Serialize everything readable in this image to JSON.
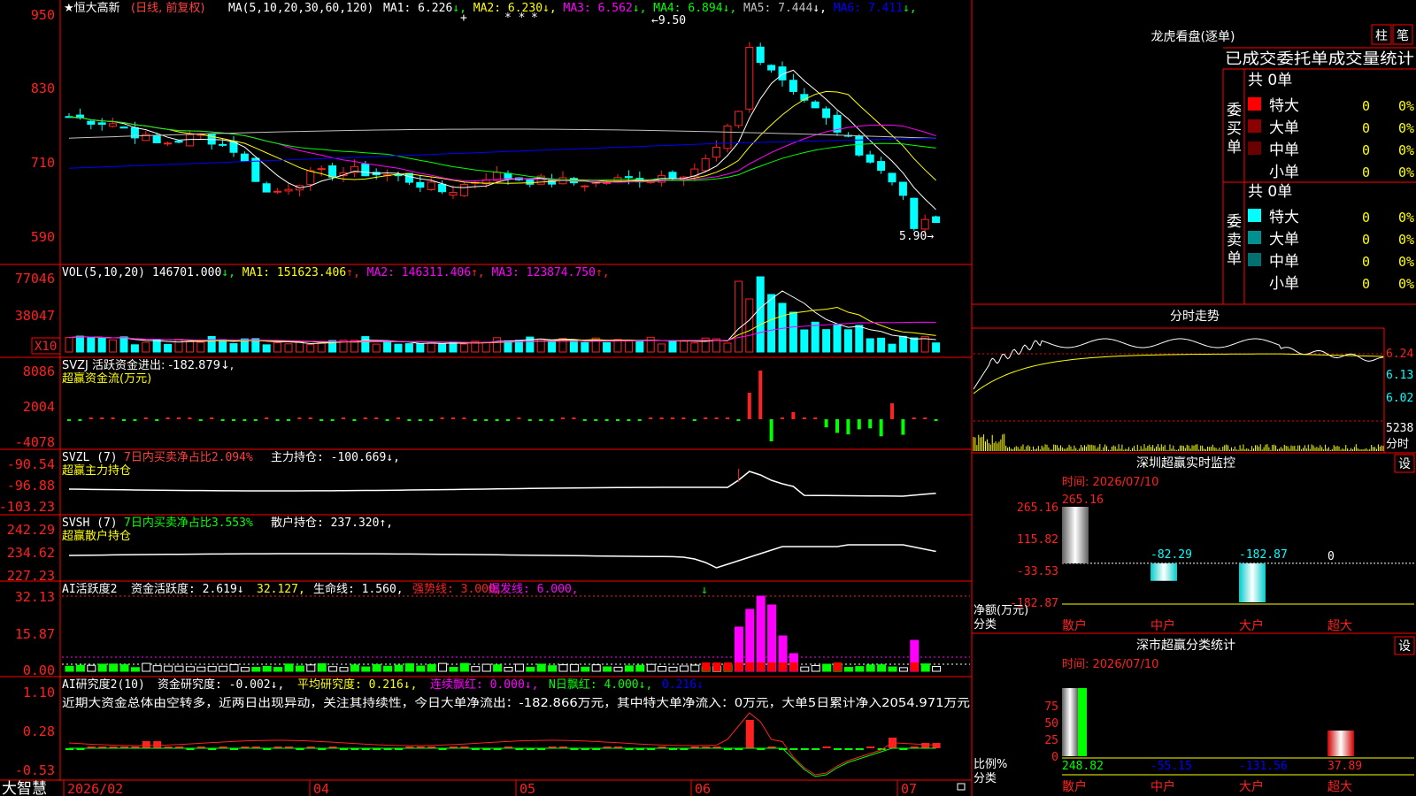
{
  "app": {
    "name": "大智慧"
  },
  "colors": {
    "up": "#ff2020",
    "down": "#00ffff",
    "ma1": "#ffffff",
    "ma2": "#ffff00",
    "ma3": "#ff00ff",
    "ma4": "#00ff00",
    "ma5": "#c0c0c0",
    "ma6": "#0000ff",
    "axis": "#ff0000",
    "bg": "#000000"
  },
  "kline": {
    "stock": "恒大高新",
    "period": "(日线, 前复权)",
    "ma_params": "MA(5,10,20,30,60,120)",
    "ma_readout": [
      {
        "label": "MA1: 6.226",
        "arrow": "↓"
      },
      {
        "label": "MA2: 6.230",
        "arrow": "↓"
      },
      {
        "label": "MA3: 6.562",
        "arrow": "↓"
      },
      {
        "label": "MA4: 6.894",
        "arrow": "↓"
      },
      {
        "label": "MA5: 7.444",
        "arrow": "↓"
      },
      {
        "label": "MA6: 7.411",
        "arrow": "↓"
      }
    ],
    "y_ticks": [
      "950",
      "830",
      "710",
      "590"
    ],
    "high_label": "9.50",
    "low_label": "5.90",
    "marks": [
      "+",
      "* *",
      "*"
    ]
  },
  "vol": {
    "header": "VOL(5,10,20)",
    "readout": [
      {
        "label": "146701.000",
        "arrow": "↓"
      },
      {
        "label": "MA1: 151623.406",
        "arrow": "↑"
      },
      {
        "label": "MA2: 146311.406",
        "arrow": "↑"
      },
      {
        "label": "MA3: 123874.750",
        "arrow": "↑"
      }
    ],
    "y_ticks": [
      "77046",
      "38047"
    ],
    "unit": "X10"
  },
  "svzj": {
    "header": "SVZJ  活跃资金进出: -182.879↓,",
    "subtitle": "超赢资金流(万元)",
    "y_ticks": [
      "8086",
      "2004",
      "-4078"
    ]
  },
  "svzl": {
    "name": "SVZL (7)",
    "ratio": "7日内买卖净占比2.094%",
    "main": "主力持仓: -100.669↓,",
    "subtitle": "超赢主力持仓",
    "y_ticks": [
      "-90.54",
      "-96.88",
      "-103.23"
    ]
  },
  "svsh": {
    "name": "SVSH (7)",
    "ratio": "7日内买卖净占比3.553%",
    "main": "散户持仓: 237.320↑,",
    "subtitle": "超赢散户持仓",
    "y_ticks": [
      "242.29",
      "234.62",
      "227.23"
    ]
  },
  "ai_active": {
    "name": "AI活跃度2",
    "a": "资金活跃度: 2.619↓",
    "b": "32.127,",
    "c": "生命线: 1.560,",
    "d": "强势线: 3.000,",
    "e": "爆发线: 6.000,",
    "y_ticks": [
      "32.13",
      "15.87",
      "0.00"
    ]
  },
  "ai_research": {
    "name": "AI研究度2(10)",
    "a": "资金研究度: -0.002↓,",
    "b": "平均研究度: 0.216↓,",
    "c": "连续飘红: 0.000↓,",
    "d": "N日飘红: 4.000↓,",
    "e": "0.216↓",
    "comment": "近期大资金总体由空转多，近两日出现异动，关注其持续性，今日大单净流出：-182.866万元，其中特大单净流入：0万元，大单5日累计净入2054.971万元",
    "y_ticks": [
      "1.10",
      "0.28",
      "-0.53"
    ]
  },
  "dates": [
    "2026/02",
    "04",
    "05",
    "06",
    "07"
  ],
  "dragon": {
    "title": "龙虎看盘(逐单)",
    "btn1": "柱",
    "btn2": "笔",
    "header": "已成交委托单成交量统计",
    "buy_label": "委买单",
    "sell_label": "委卖单",
    "buy_total": "共 0单",
    "sell_total": "共 0单",
    "buy_rows": [
      {
        "name": "特大",
        "count": "0",
        "pct": "0%"
      },
      {
        "name": "大单",
        "count": "0",
        "pct": "0%"
      },
      {
        "name": "中单",
        "count": "0",
        "pct": "0%"
      },
      {
        "name": "小单",
        "count": "0",
        "pct": "0%"
      }
    ],
    "sell_rows": [
      {
        "name": "特大",
        "count": "0",
        "pct": "0%"
      },
      {
        "name": "大单",
        "count": "0",
        "pct": "0%"
      },
      {
        "name": "中单",
        "count": "0",
        "pct": "0%"
      },
      {
        "name": "小单",
        "count": "0",
        "pct": "0%"
      }
    ]
  },
  "intraday": {
    "title": "分时走势",
    "y_ticks": [
      "6.24",
      "6.13",
      "6.02"
    ],
    "vol_label": "5238",
    "unit": "分时"
  },
  "monitor": {
    "title": "深圳超赢实时监控",
    "btn": "设",
    "time": "时间: 2026/07/10",
    "y_ticks": [
      "265.16",
      "115.82",
      "-33.53",
      "-182.87"
    ],
    "y_label": "净额(万元)",
    "x_label": "分类",
    "categories": [
      "散户",
      "中户",
      "大户",
      "超大"
    ],
    "values": [
      265.16,
      -82.29,
      -182.87,
      0
    ],
    "value_labels": [
      "265.16",
      "-82.29",
      "-182.87",
      "0"
    ]
  },
  "classify": {
    "title": "深市超赢分类统计",
    "btn": "设",
    "time": "时间: 2026/07/10",
    "y_ticks": [
      "75",
      "50",
      "25",
      "0"
    ],
    "y_label": "比例%",
    "x_label": "分类",
    "categories": [
      "散户",
      "中户",
      "大户",
      "超大"
    ],
    "value_labels": [
      "248.82",
      "-55.15",
      "-131.56",
      "37.89"
    ]
  },
  "chart_data": [
    {
      "type": "bar",
      "title": "深圳超赢实时监控",
      "ylabel": "净额(万元)",
      "xlabel": "分类",
      "categories": [
        "散户",
        "中户",
        "大户",
        "超大"
      ],
      "values": [
        265.16,
        -82.29,
        -182.87,
        0
      ],
      "ylim": [
        -182.87,
        265.16
      ]
    },
    {
      "type": "bar",
      "title": "深市超赢分类统计",
      "ylabel": "比例%",
      "xlabel": "分类",
      "categories": [
        "散户",
        "中户",
        "大户",
        "超大"
      ],
      "values": [
        248.82,
        -55.15,
        -131.56,
        37.89
      ]
    }
  ]
}
